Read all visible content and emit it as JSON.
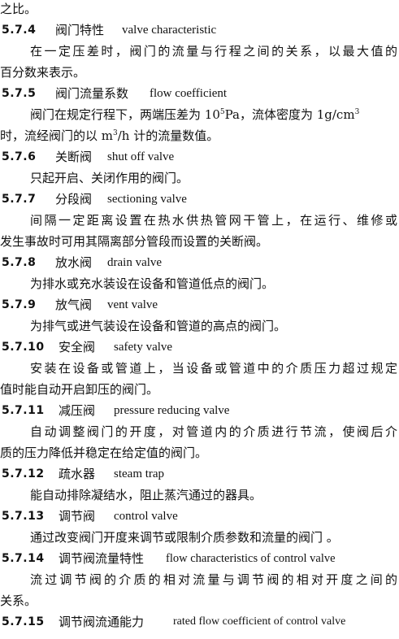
{
  "lead": {
    "text": "之比。"
  },
  "entries": [
    {
      "number": "5.7.4",
      "term_cn": "阀门特性",
      "term_en": "valve characteristic",
      "lines": [
        "在一定压差时，阀门的流量与行程之间的关系，以最大值的",
        "百分数来表示。"
      ]
    },
    {
      "number": "5.7.5",
      "term_cn": "阀门流量系数",
      "term_en": "flow coefficient",
      "line1_a": "阀门在规定行程下，两端压差为 10",
      "line1_sup1": "5",
      "line1_b": "Pa，流体密度为 1g/cm",
      "line1_sup2": "3",
      "line2_a": "时，流经阀门的以 m",
      "line2_sup": "3",
      "line2_b": "/h 计的流量数值。"
    },
    {
      "number": "5.7.6",
      "term_cn": "关断阀",
      "term_en": "shut off valve",
      "lines": [
        "只起开启、关闭作用的阀门。"
      ]
    },
    {
      "number": "5.7.7",
      "term_cn": "分段阀",
      "term_en": "sectioning valve",
      "lines": [
        "间隔一定距离设置在热水供热管网干管上，在运行、维修或",
        "发生事故时可用其隔离部分管段而设置的关断阀。"
      ]
    },
    {
      "number": "5.7.8",
      "term_cn": "放水阀",
      "term_en": "drain valve",
      "lines": [
        "为排水或充水装设在设备和管道低点的阀门。"
      ]
    },
    {
      "number": "5.7.9",
      "term_cn": "放气阀",
      "term_en": "vent valve",
      "lines": [
        "为排气或进气装设在设备和管道的高点的阀门。"
      ]
    },
    {
      "number": "5.7.10",
      "term_cn": "安全阀",
      "term_en": "safety valve",
      "lines": [
        "安装在设备或管道上，当设备或管道中的介质压力超过规定",
        "值时能自动开启卸压的阀门。"
      ]
    },
    {
      "number": "5.7.11",
      "term_cn": "减压阀",
      "term_en": "pressure reducing valve",
      "lines": [
        "自动调整阀门的开度，对管道内的介质进行节流，使阀后介",
        "质的压力降低并稳定在给定值的阀门。"
      ]
    },
    {
      "number": "5.7.12",
      "term_cn": "疏水器",
      "term_en": "steam trap",
      "lines": [
        "能自动排除凝结水，阻止蒸汽通过的器具。"
      ]
    },
    {
      "number": "5.7.13",
      "term_cn": "调节阀",
      "term_en": "control valve",
      "lines": [
        "通过改变阀门开度来调节或限制介质参数和流量的阀门 。"
      ]
    },
    {
      "number": "5.7.14",
      "term_cn": "调节阀流量特性",
      "term_en": "flow characteristics of control valve",
      "lines": [
        "流过调节阀的介质的相对流量与调节阀的相对开度之间的",
        "关系。"
      ]
    },
    {
      "number": "5.7.15",
      "term_cn": "调节阀流通能力",
      "term_en": "rated flow coefficient of control valve"
    }
  ]
}
